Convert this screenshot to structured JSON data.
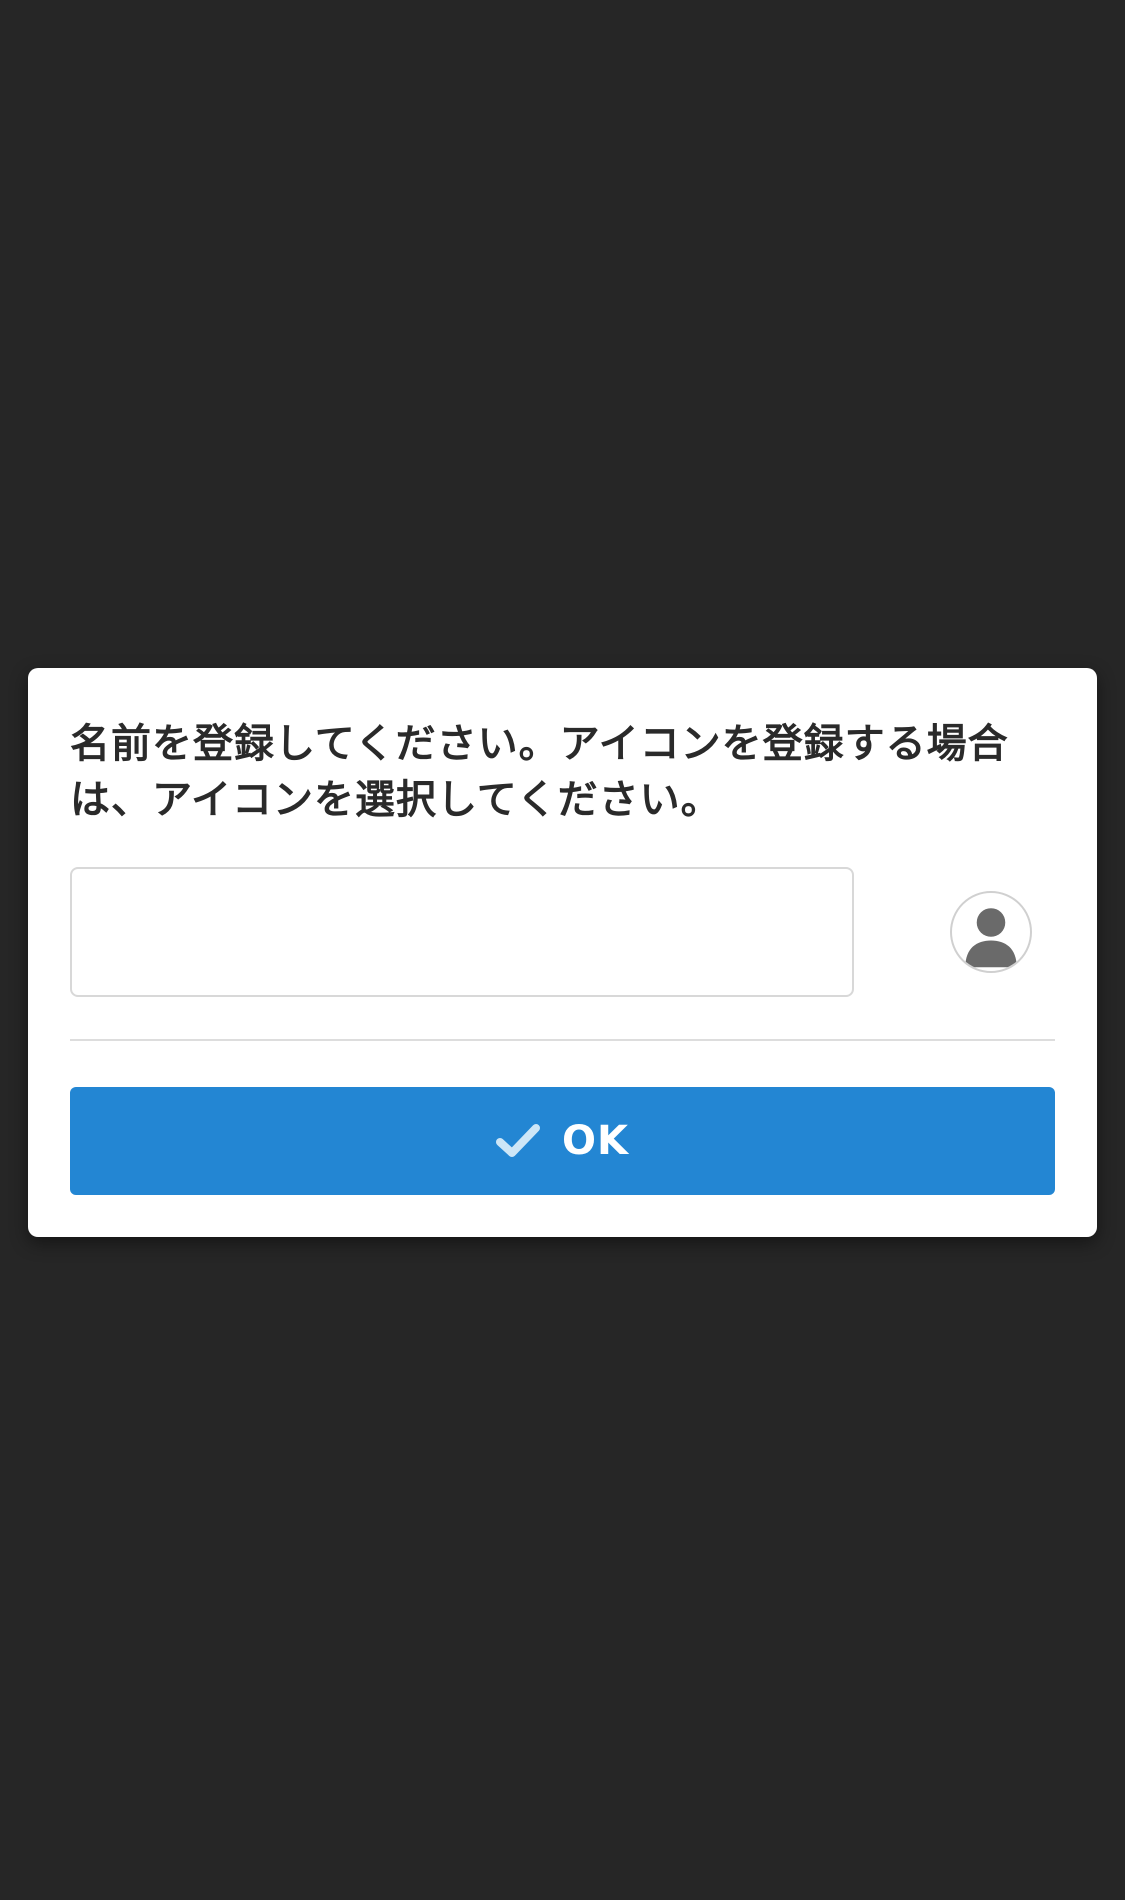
{
  "dialog": {
    "message": "名前を登録してください。アイコンを登録する場合は、アイコンを選択してください。",
    "name_input": {
      "value": "",
      "placeholder": ""
    },
    "avatar": {
      "icon": "user-silhouette-icon"
    },
    "ok_button": {
      "label": "OK",
      "icon": "check-icon"
    }
  },
  "colors": {
    "background": "#262626",
    "dialog_background": "#ffffff",
    "accent": "#2386d3",
    "text": "#2a2a2a",
    "check_icon": "#cde6f7",
    "avatar_silhouette": "#6a6a6a"
  }
}
